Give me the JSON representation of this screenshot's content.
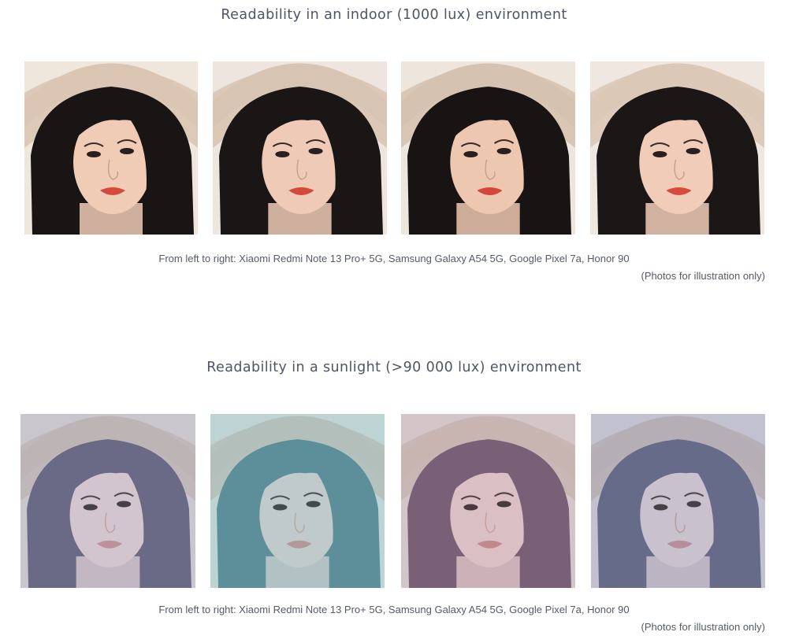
{
  "sections": [
    {
      "title": "Readability in an indoor (1000 lux) environment",
      "caption": "From left to right: Xiaomi Redmi Note 13 Pro+ 5G, Samsung Galaxy A54 5G, Google Pixel 7a, Honor 90",
      "note": "(Photos for illustration only)",
      "photos": [
        {
          "device": "Xiaomi Redmi Note 13 Pro+ 5G",
          "bg": "#efe6dc",
          "hat": "#d9c5b2",
          "hair": "#1a1515",
          "skin": "#f0cbb6",
          "lips": "#d54a3a",
          "tint": "#000000",
          "tintOpacity": 0
        },
        {
          "device": "Samsung Galaxy A54 5G",
          "bg": "#eee6de",
          "hat": "#d8c4b3",
          "hair": "#1b1616",
          "skin": "#efcab6",
          "lips": "#d5493c",
          "tint": "#000000",
          "tintOpacity": 0
        },
        {
          "device": "Google Pixel 7a",
          "bg": "#eee5dc",
          "hat": "#d6c2b0",
          "hair": "#191414",
          "skin": "#eec7b1",
          "lips": "#d4463a",
          "tint": "#000000",
          "tintOpacity": 0
        },
        {
          "device": "Honor 90",
          "bg": "#f0e8e0",
          "hat": "#dbc8b7",
          "hair": "#1c1717",
          "skin": "#f1cdb9",
          "lips": "#d74b3d",
          "tint": "#000000",
          "tintOpacity": 0
        }
      ]
    },
    {
      "title": "Readability in a sunlight (>90 000 lux) environment",
      "caption": "From left to right: Xiaomi Redmi Note 13 Pro+ 5G, Samsung Galaxy A54 5G, Google Pixel 7a, Honor 90",
      "note": "(Photos for illustration only)",
      "photos": [
        {
          "device": "Xiaomi Redmi Note 13 Pro+ 5G",
          "bg": "#d9d2cf",
          "hat": "#c9b9b0",
          "hair": "#5a5470",
          "skin": "#e6cfd0",
          "lips": "#c98a8c",
          "tint": "#9aa8c8",
          "tintOpacity": 0.25
        },
        {
          "device": "Samsung Galaxy A54 5G",
          "bg": "#d6dcd8",
          "hat": "#c8c0b4",
          "hair": "#4f7d88",
          "skin": "#dccfcb",
          "lips": "#c88a86",
          "tint": "#7cc0c8",
          "tintOpacity": 0.28
        },
        {
          "device": "Google Pixel 7a",
          "bg": "#ddd3cf",
          "hat": "#cdbcb3",
          "hair": "#6a5066",
          "skin": "#e4cbc9",
          "lips": "#c68482",
          "tint": "#b59ab0",
          "tintOpacity": 0.22
        },
        {
          "device": "Honor 90",
          "bg": "#d4d2d8",
          "hat": "#c4b8b5",
          "hair": "#565a78",
          "skin": "#e0d2d6",
          "lips": "#c58a90",
          "tint": "#8e96b8",
          "tintOpacity": 0.28
        }
      ]
    }
  ]
}
